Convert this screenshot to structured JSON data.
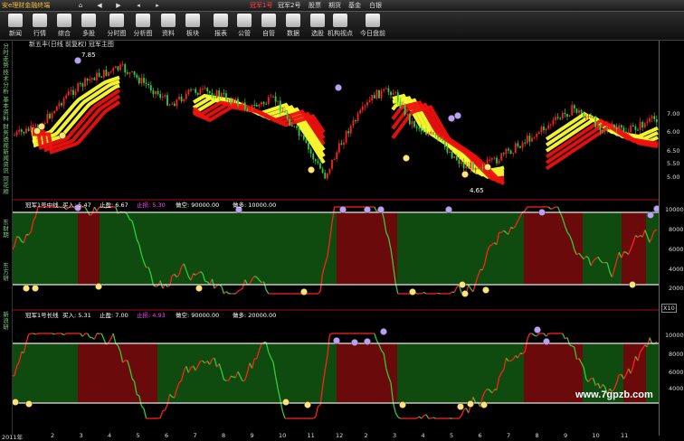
{
  "app": {
    "title": "安e理财金融终端"
  },
  "nav": {
    "back": "◀",
    "forward": "▶",
    "home": "⌂",
    "prev": "◂",
    "next": "▸"
  },
  "menu": [
    {
      "label": "冠军1号",
      "active": true
    },
    {
      "label": "冠军2号",
      "active": false
    },
    {
      "label": "股票",
      "active": false
    },
    {
      "label": "期货",
      "active": false
    },
    {
      "label": "基金",
      "active": false
    },
    {
      "label": "白银",
      "active": false
    }
  ],
  "toolbar": [
    {
      "label": "新闻",
      "icon": "newspaper-icon"
    },
    {
      "label": "行情",
      "icon": "quotes-icon"
    },
    {
      "label": "综合",
      "icon": "overview-icon"
    },
    {
      "label": "多股",
      "icon": "multi-stock-icon"
    },
    {
      "label": "分时图",
      "icon": "intraday-chart-icon"
    },
    {
      "label": "分析图",
      "icon": "analysis-chart-icon"
    },
    {
      "label": "资料",
      "icon": "info-icon"
    },
    {
      "label": "板块",
      "icon": "sector-icon"
    },
    {
      "label": "报表",
      "icon": "report-icon"
    },
    {
      "label": "公管",
      "icon": "company-icon"
    },
    {
      "label": "自管",
      "icon": "portfolio-icon"
    },
    {
      "label": "数据",
      "icon": "data-icon"
    },
    {
      "label": "选股",
      "icon": "stock-picker-icon"
    },
    {
      "label": "机构视点",
      "icon": "institution-icon"
    },
    {
      "label": "今日盘前",
      "icon": "premarket-icon"
    }
  ],
  "sidebar": {
    "tabs": [
      "分时走势",
      "技术分析",
      "基本资料",
      "财务透视",
      "新闻资讯",
      "同花顺",
      "东财期",
      "东方研",
      "新浪研"
    ]
  },
  "main_chart": {
    "title": "新五丰(日线 前复权) 冠军主图",
    "high_label": "7.85",
    "low_label": "4.65",
    "axis": [
      "7.00",
      "6.50",
      "6.00",
      "5.50",
      "5.00"
    ]
  },
  "panel1": {
    "name": "冠军1号中线",
    "buy": "买入: 5.47",
    "profit": "止盈: 6.67",
    "loss": "止损: 5.30",
    "short": "做空: 90000.00",
    "long": "做多: 10000.00",
    "axis": [
      "10000",
      "8000",
      "6000",
      "4000",
      "2000"
    ],
    "unit": "X10"
  },
  "panel2": {
    "name": "冠军1号长线",
    "buy": "买入: 5.31",
    "profit": "止盈: 7.00",
    "loss": "止损: 4.93",
    "short": "做空: 90000.00",
    "long": "做多: 20000.00",
    "axis": [
      "10000",
      "8000",
      "6000",
      "4000"
    ]
  },
  "xaxis": {
    "year": "2011年",
    "months": [
      "2",
      "3",
      "4",
      "5",
      "6",
      "7",
      "8",
      "9",
      "10",
      "11",
      "12",
      "2",
      "3",
      "4",
      "5",
      "6",
      "7",
      "8",
      "9",
      "10",
      "11"
    ]
  },
  "watermark": "www.7gpzb.com",
  "colors": {
    "up": "#ff2020",
    "down": "#2ecc40",
    "band_yellow": "#ffff30",
    "band_red": "#ee1010",
    "zone_green": "#0f4a0f",
    "zone_red": "#6a0a0a"
  }
}
